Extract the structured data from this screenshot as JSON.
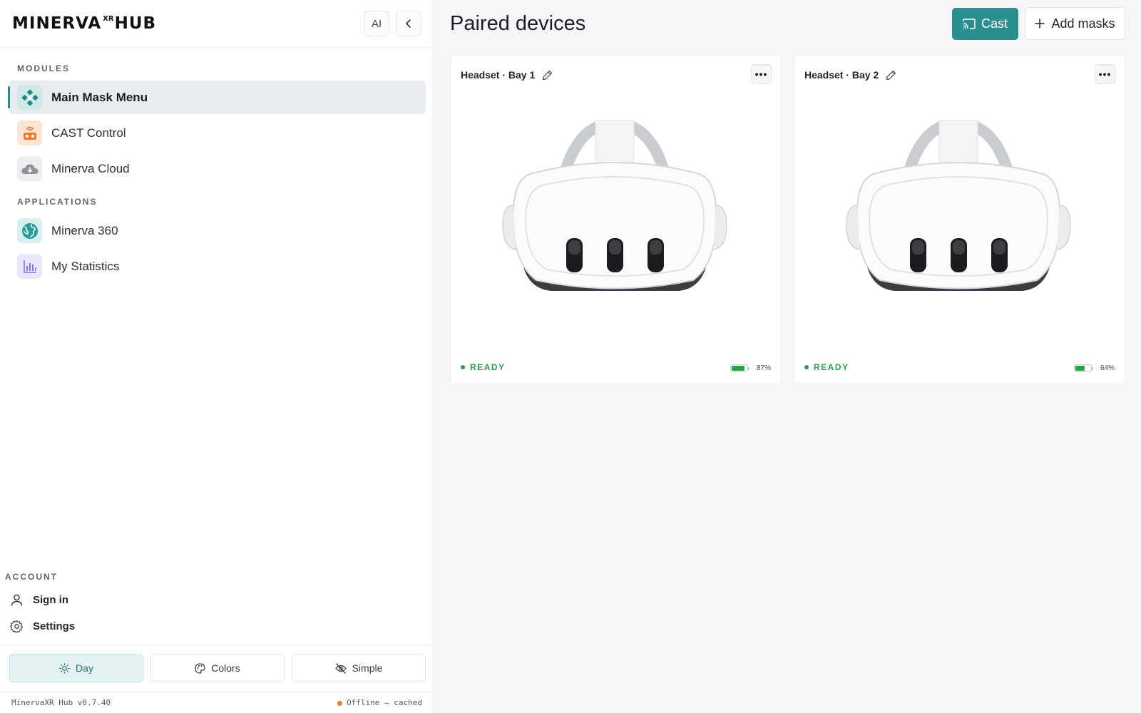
{
  "app": {
    "logo_main": "MINERVA",
    "logo_sup": "XR",
    "logo_tail": "HUB",
    "ai_button": "AI",
    "accent_color": "#2a8f8e"
  },
  "sidebar": {
    "modules_label": "MODULES",
    "applications_label": "APPLICATIONS",
    "modules": [
      {
        "label": "Main Mask Menu",
        "icon": "mask-menu-icon",
        "active": true
      },
      {
        "label": "CAST Control",
        "icon": "cast-control-icon",
        "active": false
      },
      {
        "label": "Minerva Cloud",
        "icon": "cloud-download-icon",
        "active": false
      }
    ],
    "applications": [
      {
        "label": "Minerva 360",
        "icon": "globe-icon"
      },
      {
        "label": "My Statistics",
        "icon": "bar-chart-icon"
      }
    ],
    "account_label": "ACCOUNT",
    "account_items": [
      {
        "label": "Sign in",
        "icon": "user-icon"
      },
      {
        "label": "Settings",
        "icon": "gear-icon"
      }
    ],
    "modes": [
      {
        "label": "Day",
        "icon": "sun-icon",
        "active": true
      },
      {
        "label": "Colors",
        "icon": "palette-icon",
        "active": false
      },
      {
        "label": "Simple",
        "icon": "eye-off-icon",
        "active": false
      }
    ],
    "version": "MinervaXR Hub v0.7.40",
    "connection": "Offline — cached"
  },
  "main": {
    "title": "Paired devices",
    "cast_button": "Cast",
    "add_button": "Add masks",
    "devices": [
      {
        "name": "Headset · Bay 1",
        "status": "READY",
        "battery_label": "87%",
        "battery_level": 0.87
      },
      {
        "name": "Headset · Bay 2",
        "status": "READY",
        "battery_label": "64%",
        "battery_level": 0.64
      }
    ]
  }
}
